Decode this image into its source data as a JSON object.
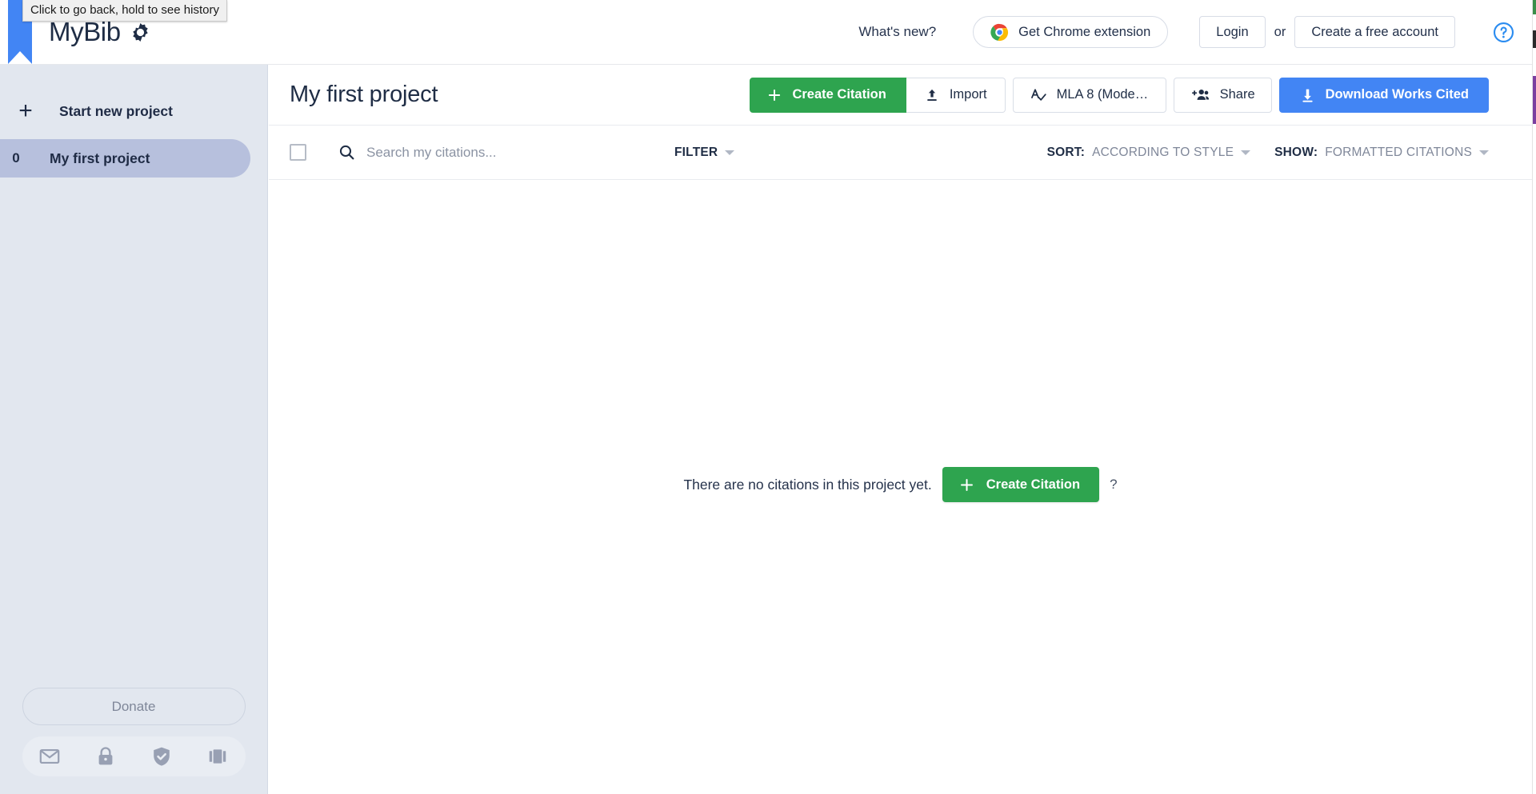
{
  "browser": {
    "back_tooltip": "Click to go back, hold to see history"
  },
  "header": {
    "logo_text": "MyBib",
    "logo_icon": "gear-icon",
    "whats_new": "What's new?",
    "chrome_extension": "Get Chrome extension",
    "chrome_icon": "chrome-icon",
    "login": "Login",
    "or": "or",
    "create_account": "Create a free account",
    "help_icon": "help-circle-icon"
  },
  "sidebar": {
    "new_project": {
      "label": "Start new project",
      "icon": "plus-icon"
    },
    "projects": [
      {
        "count": "0",
        "label": "My first project",
        "selected": true
      }
    ],
    "donate": "Donate",
    "footer_icons": [
      "mail-icon",
      "lock-icon",
      "shield-check-icon",
      "book-icon"
    ]
  },
  "main": {
    "project_title": "My first project",
    "toolbar": {
      "create_citation": "Create Citation",
      "create_citation_icon": "plus-icon",
      "import": "Import",
      "import_icon": "upload-icon",
      "style": "MLA 8 (Modern ...",
      "style_icon": "spellcheck-icon",
      "share": "Share",
      "share_icon": "person-add-icon",
      "download": "Download Works Cited",
      "download_icon": "download-icon"
    },
    "filterbar": {
      "select_all_checkbox": "unchecked",
      "search_icon": "search-icon",
      "search_value": "",
      "search_placeholder": "Search my citations...",
      "filter_label": "FILTER",
      "sort_key": "SORT:",
      "sort_value": "ACCORDING TO STYLE",
      "show_key": "SHOW:",
      "show_value": "FORMATTED CITATIONS"
    },
    "empty_state": {
      "message": "There are no citations in this project yet.",
      "button": "Create Citation",
      "button_icon": "plus-icon",
      "help": "?"
    }
  },
  "colors": {
    "green": "#2ea44f",
    "blue": "#4285f4",
    "sidebar_bg": "#e2e7ef",
    "selected_project": "#b7c0dd",
    "text_dark": "#1f2d45",
    "muted": "#7f8799"
  }
}
